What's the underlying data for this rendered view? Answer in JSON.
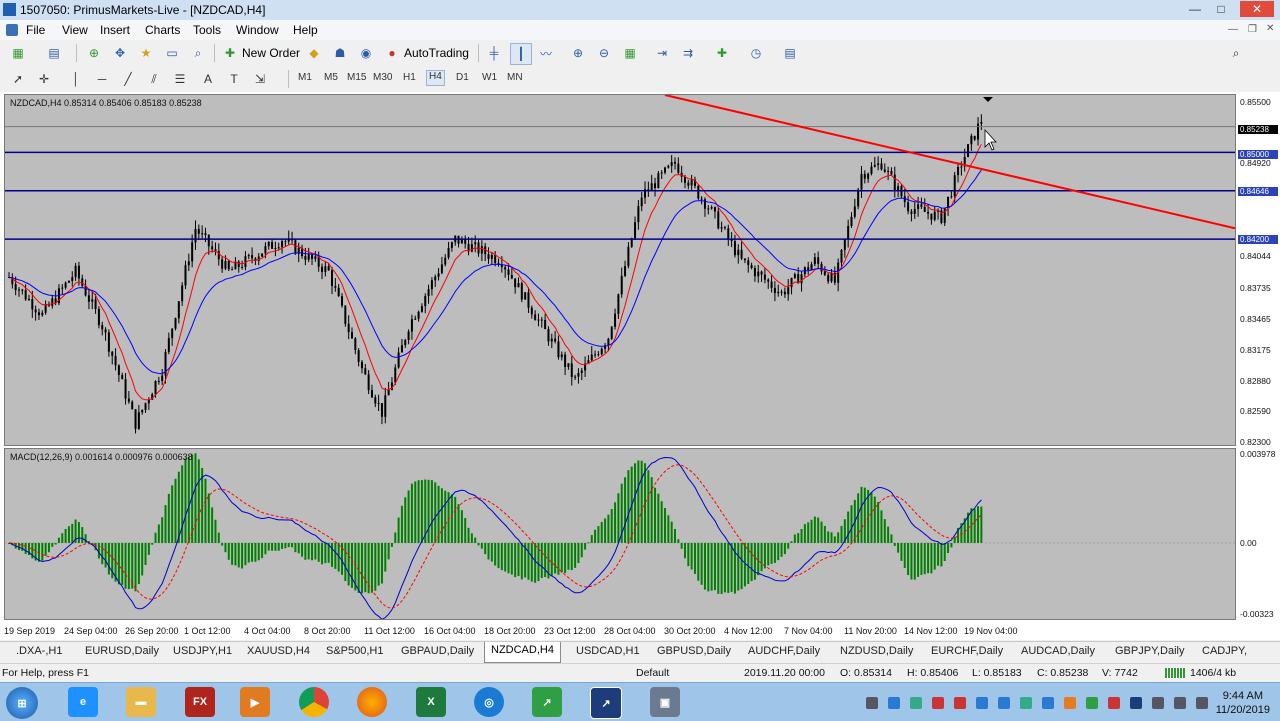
{
  "window": {
    "title": "1507050: PrimusMarkets-Live - [NZDCAD,H4]",
    "minimize": "—",
    "maximize": "□",
    "close": "✕"
  },
  "menu": [
    "File",
    "View",
    "Insert",
    "Charts",
    "Tools",
    "Window",
    "Help"
  ],
  "toolbar": {
    "new_order": "New Order",
    "auto_trading": "AutoTrading"
  },
  "timeframes": [
    "M1",
    "M5",
    "M15",
    "M30",
    "H1",
    "H4",
    "D1",
    "W1",
    "MN"
  ],
  "active_timeframe": "H4",
  "main_chart": {
    "header": "NZDCAD,H4  0.85314 0.85406 0.85183 0.85238",
    "price_axis": [
      "0.85500",
      "0.84920",
      "0.84044",
      "0.83735",
      "0.83465",
      "0.83175",
      "0.82880",
      "0.82590",
      "0.82300"
    ],
    "tags": {
      "bid": "0.85238",
      "line1": "0.85000",
      "line2": "0.84646",
      "line3": "0.84200"
    },
    "colors": {
      "background": "#bdbdbd",
      "candle": "#000000",
      "ma_fast": "#ff0000",
      "ma_slow": "#0000ff",
      "trendline": "#ff0000",
      "hline": "#00008b"
    }
  },
  "macd": {
    "header": "MACD(12,26,9) 0.001614 0.000976 0.000638",
    "axis": [
      "0.003978",
      "0.00",
      "-0.00323"
    ],
    "colors": {
      "histogram": "#008000",
      "main": "#0000cd",
      "signal": "#ff0000"
    }
  },
  "time_axis": [
    "19 Sep 2019",
    "24 Sep 04:00",
    "26 Sep 20:00",
    "1 Oct 12:00",
    "4 Oct 04:00",
    "8 Oct 20:00",
    "11 Oct 12:00",
    "16 Oct 04:00",
    "18 Oct 20:00",
    "23 Oct 12:00",
    "28 Oct 04:00",
    "30 Oct 20:00",
    "4 Nov 12:00",
    "7 Nov 04:00",
    "11 Nov 20:00",
    "14 Nov 12:00",
    "19 Nov 04:00"
  ],
  "tabs": [
    ".DXA-,H1",
    "EURUSD,Daily",
    "USDJPY,H1",
    "XAUUSD,H4",
    "S&P500,H1",
    "GBPAUD,Daily",
    "NZDCAD,H4",
    "USDCAD,H1",
    "GBPUSD,Daily",
    "AUDCHF,Daily",
    "NZDUSD,Daily",
    "EURCHF,Daily",
    "AUDCAD,Daily",
    "GBPJPY,Daily",
    "CADJPY,"
  ],
  "active_tab": "NZDCAD,H4",
  "status": {
    "help": "For Help, press F1",
    "profile": "Default",
    "datetime": "2019.11.20 00:00",
    "open": "O: 0.85314",
    "high": "H: 0.85406",
    "low": "L: 0.85183",
    "close": "C: 0.85238",
    "volume": "V: 7742",
    "traffic": "1406/4 kb"
  },
  "taskbar": {
    "time": "9:44 AM",
    "date": "11/20/2019",
    "apps": [
      "start-orb",
      "internet-explorer",
      "file-explorer",
      "fxpro",
      "media-player",
      "chrome",
      "firefox",
      "excel",
      "network",
      "metatrader-green",
      "metatrader-blue",
      "storage"
    ]
  }
}
